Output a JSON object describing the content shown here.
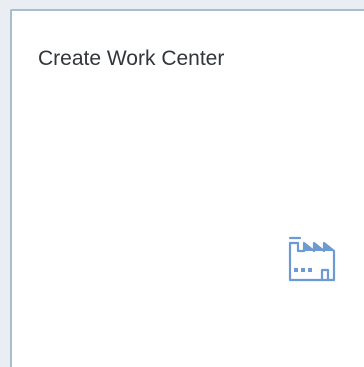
{
  "tile": {
    "title": "Create Work Center",
    "icon": "factory-icon",
    "icon_color": "#6d9bd1",
    "border_color": "#a9bdd1"
  }
}
